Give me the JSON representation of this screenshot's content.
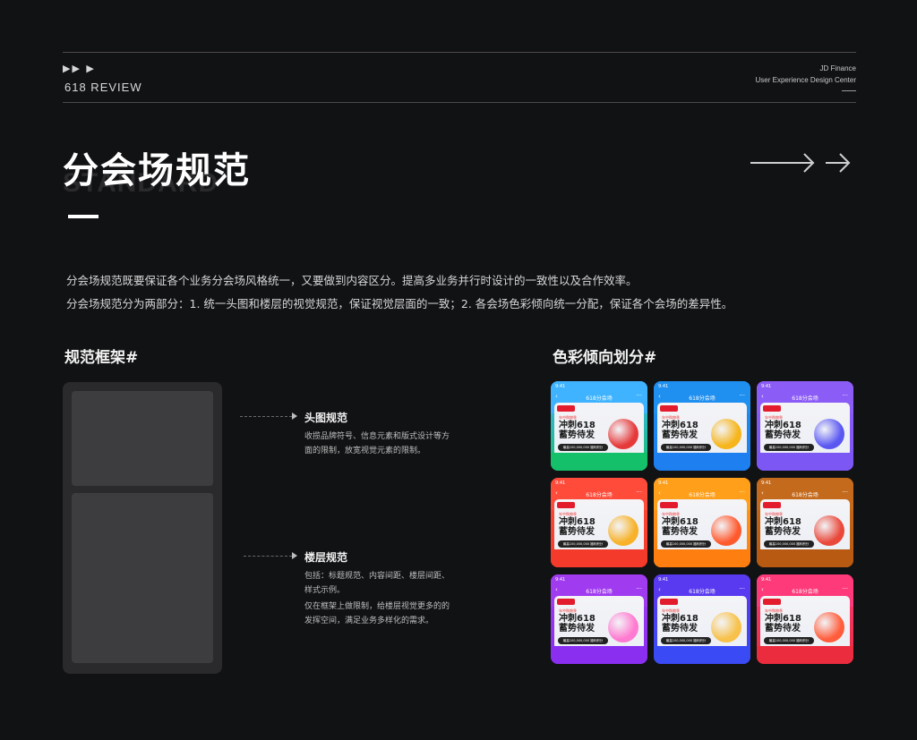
{
  "header": {
    "arrows": "▶▶  ▶",
    "review": "618 REVIEW",
    "org_line1": "JD Finance",
    "org_line2": "User Experience Design Center"
  },
  "title": {
    "main": "分会场规范",
    "ghost": "STANDARD"
  },
  "description": {
    "line1": "分会场规范既要保证各个业务分会场风格统一，又要做到内容区分。提高多业务并行时设计的一致性以及合作效率。",
    "line2": "分会场规范分为两部分：1. 统一头图和楼层的视觉规范，保证视觉层面的一致；2. 各会场色彩倾向统一分配，保证各个会场的差异性。"
  },
  "framework": {
    "heading": "规范框架#",
    "header_spec": {
      "label": "头图规范",
      "note": "收揽品牌符号、信息元素和版式设计等方面的限制，放宽视觉元素的限制。"
    },
    "floor_spec": {
      "label": "楼层规范",
      "note1": "包括：标题规范、内容间距、楼层间距、样式示例。",
      "note2": "仅在框架上做限制，给楼层视觉更多的的发挥空间，满足业务多样化的需求。"
    }
  },
  "colors": {
    "heading": "色彩倾向划分#",
    "card_text": {
      "status": "9:41",
      "title": "618分会场",
      "subtitle": "年中购物季",
      "headline": "冲刺618 蓄势待发",
      "pill": "最高100,000,000 福利积分"
    },
    "cards": [
      {
        "top": "#3fb3ff",
        "base": "#15c06a",
        "obj": "#e63a3a"
      },
      {
        "top": "#1f8ff0",
        "base": "#1e7ff0",
        "obj": "#f6b51c"
      },
      {
        "top": "#8b5cf6",
        "base": "#7d57f4",
        "obj": "#5b58f2"
      },
      {
        "top": "#ff4b3a",
        "base": "#f43a2a",
        "obj": "#f7b229"
      },
      {
        "top": "#ff9f1a",
        "base": "#ff7e10",
        "obj": "#ff5a2e"
      },
      {
        "top": "#c46a1c",
        "base": "#b85a12",
        "obj": "#e9483a"
      },
      {
        "top": "#a03bf0",
        "base": "#8a2ff0",
        "obj": "#ff7ad0"
      },
      {
        "top": "#5a3af0",
        "base": "#3a4af5",
        "obj": "#f7c14a"
      },
      {
        "top": "#ff3a7a",
        "base": "#ea2c3e",
        "obj": "#ff5d3b"
      }
    ]
  }
}
